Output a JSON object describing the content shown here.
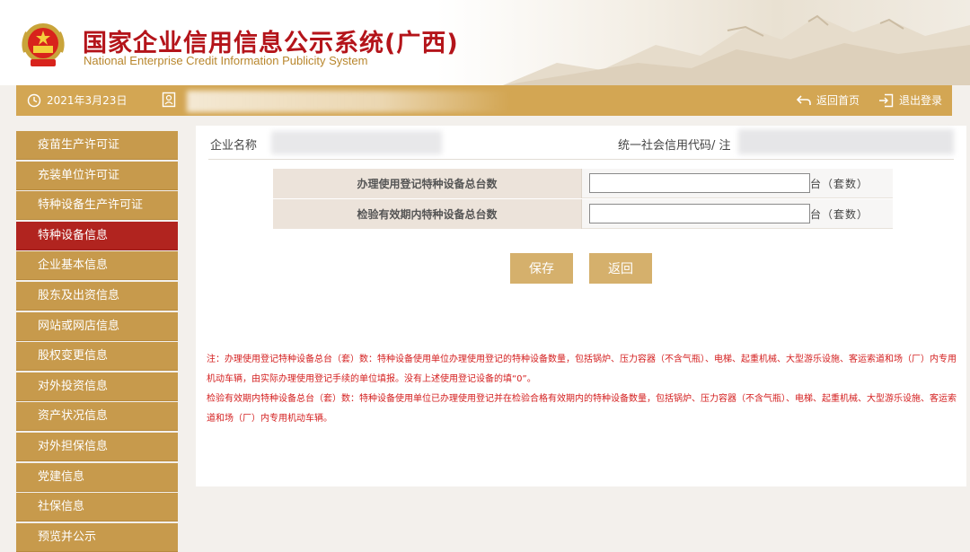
{
  "header": {
    "title_cn": "国家企业信用信息公示系统(广西)",
    "title_en": "National Enterprise Credit Information Publicity System"
  },
  "topbar": {
    "date": "2021年3月23日",
    "home_label": "返回首页",
    "logout_label": "退出登录"
  },
  "sidebar": {
    "items": [
      {
        "label": "疫苗生产许可证",
        "active": false
      },
      {
        "label": "充装单位许可证",
        "active": false
      },
      {
        "label": "特种设备生产许可证",
        "active": false
      },
      {
        "label": "特种设备信息",
        "active": true
      },
      {
        "label": "企业基本信息",
        "active": false
      },
      {
        "label": "股东及出资信息",
        "active": false
      },
      {
        "label": "网站或网店信息",
        "active": false
      },
      {
        "label": "股权变更信息",
        "active": false
      },
      {
        "label": "对外投资信息",
        "active": false
      },
      {
        "label": "资产状况信息",
        "active": false
      },
      {
        "label": "对外担保信息",
        "active": false
      },
      {
        "label": "党建信息",
        "active": false
      },
      {
        "label": "社保信息",
        "active": false
      },
      {
        "label": "预览并公示",
        "active": false
      }
    ]
  },
  "info": {
    "company_label": "企业名称",
    "credit_code_label": "统一社会信用代码/ 注"
  },
  "form": {
    "rows": [
      {
        "label": "办理使用登记特种设备总台数",
        "value": "",
        "unit": "台（套数）"
      },
      {
        "label": "检验有效期内特种设备总台数",
        "value": "",
        "unit": "台（套数）"
      }
    ],
    "save_label": "保存",
    "back_label": "返回"
  },
  "notes": {
    "line1": "注：办理使用登记特种设备总台（套）数：特种设备使用单位办理使用登记的特种设备数量，包括锅炉、压力容器（不含气瓶）、电梯、起重机械、大型游乐设施、客运索道和场（厂）内专用机动车辆，由实际办理使用登记手续的单位填报。没有上述使用登记设备的填“0”。",
    "line2": "检验有效期内特种设备总台（套）数：特种设备使用单位已办理使用登记并在检验合格有效期内的特种设备数量，包括锅炉、压力容器（不含气瓶）、电梯、起重机械、大型游乐设施、客运索道和场（厂）内专用机动车辆。"
  },
  "colors": {
    "brand_red": "#b4141a",
    "gold": "#d3a653",
    "menu": "#c79a4c",
    "menu_active": "#b1241f",
    "note_red": "#d42020"
  }
}
